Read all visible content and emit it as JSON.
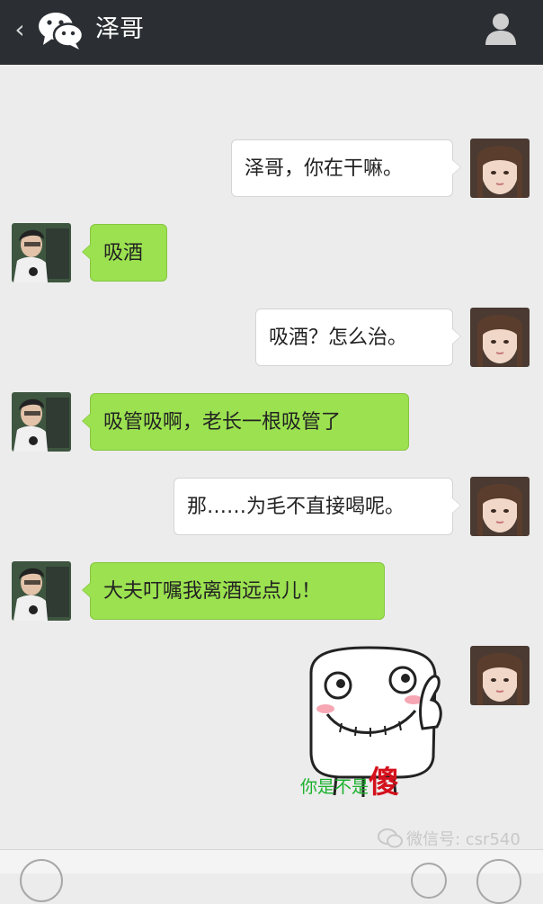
{
  "header": {
    "title": "泽哥",
    "back_icon": "chevron-left-icon",
    "app_icon": "wechat-icon",
    "profile_icon": "user-profile-icon"
  },
  "messages": [
    {
      "side": "sent",
      "text": "泽哥，你在干嘛。"
    },
    {
      "side": "received",
      "text": "吸酒"
    },
    {
      "side": "sent",
      "text": "吸酒？怎么治。"
    },
    {
      "side": "received",
      "text": "吸管吸啊，老长一根吸管了"
    },
    {
      "side": "sent",
      "text": "那……为毛不直接喝呢。"
    },
    {
      "side": "received",
      "text": "大夫叮嘱我离酒远点儿！"
    },
    {
      "side": "sent",
      "type": "sticker",
      "text_part1": "你是不是",
      "text_part2": "傻"
    }
  ],
  "watermark": {
    "text": "微信号: csr540",
    "icon": "wechat-icon"
  },
  "colors": {
    "header_bg": "#2b2f33",
    "chat_bg": "#ececec",
    "sent_bubble": "#ffffff",
    "received_bubble": "#9be150"
  }
}
